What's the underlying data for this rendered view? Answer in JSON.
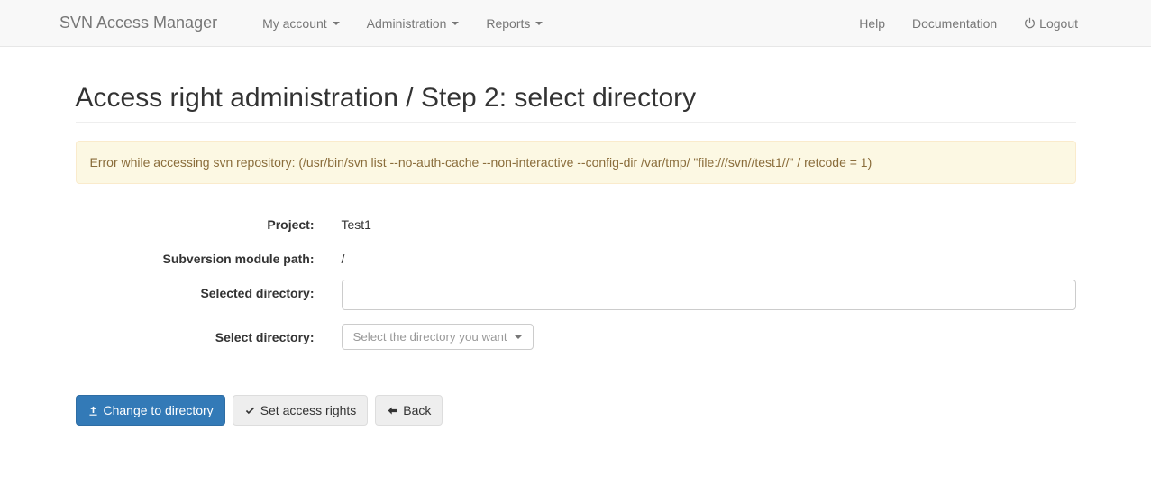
{
  "navbar": {
    "brand": "SVN Access Manager",
    "left": [
      {
        "label": "My account",
        "dropdown": true
      },
      {
        "label": "Administration",
        "dropdown": true
      },
      {
        "label": "Reports",
        "dropdown": true
      }
    ],
    "right": [
      {
        "label": "Help"
      },
      {
        "label": "Documentation"
      },
      {
        "label": "Logout",
        "icon": "power-icon"
      }
    ]
  },
  "page": {
    "title": "Access right administration / Step 2: select directory",
    "alert": "Error while accessing svn repository: (/usr/bin/svn list --no-auth-cache --non-interactive --config-dir /var/tmp/ \"file:///svn//test1//\" / retcode = 1)"
  },
  "form": {
    "project_label": "Project:",
    "project_value": "Test1",
    "module_path_label": "Subversion module path:",
    "module_path_value": "/",
    "selected_dir_label": "Selected directory:",
    "selected_dir_value": "",
    "select_dir_label": "Select directory:",
    "select_dir_placeholder": "Select the directory you want"
  },
  "buttons": {
    "change": "Change to directory",
    "set_rights": "Set access rights",
    "back": "Back"
  }
}
